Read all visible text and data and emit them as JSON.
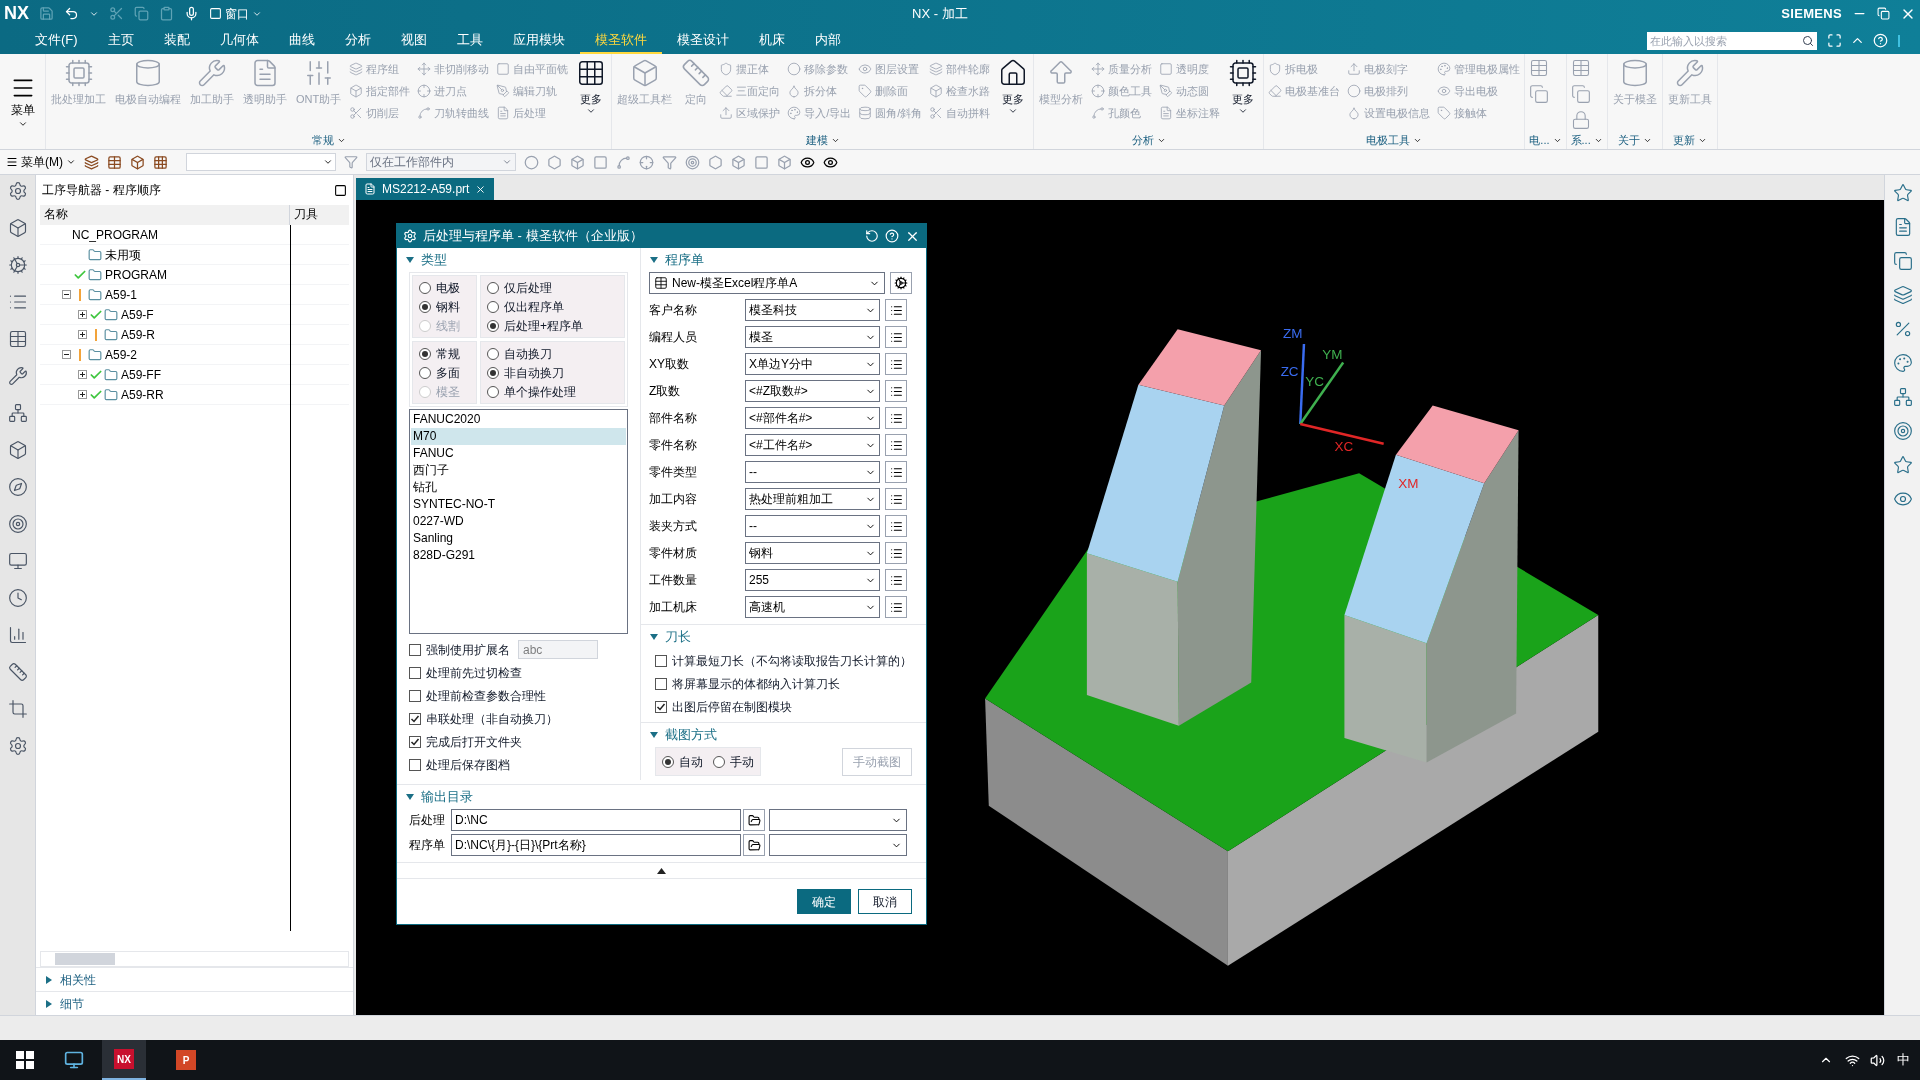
{
  "title_bar": {
    "logo": "NX",
    "window_menu": "窗口",
    "title": "NX - 加工",
    "brand": "SIEMENS"
  },
  "menu_tabs": [
    {
      "label": "文件(F)",
      "selected": false
    },
    {
      "label": "主页",
      "selected": false
    },
    {
      "label": "装配",
      "selected": false
    },
    {
      "label": "几何体",
      "selected": false
    },
    {
      "label": "曲线",
      "selected": false
    },
    {
      "label": "分析",
      "selected": false
    },
    {
      "label": "视图",
      "selected": false
    },
    {
      "label": "工具",
      "selected": false
    },
    {
      "label": "应用模块",
      "selected": false
    },
    {
      "label": "模圣软件",
      "selected": true
    },
    {
      "label": "模圣设计",
      "selected": false
    },
    {
      "label": "机床",
      "selected": false
    },
    {
      "label": "内部",
      "selected": false
    }
  ],
  "search": {
    "placeholder": "在此输入以搜索"
  },
  "ribbon": {
    "menu_button": "菜单",
    "groups": [
      {
        "label": "常规",
        "columns": [
          {
            "kind": "big",
            "label": "批处理加工",
            "disabled": true
          },
          {
            "kind": "big",
            "label": "电极自动编程",
            "disabled": true
          },
          {
            "kind": "big",
            "label": "加工助手",
            "disabled": true
          },
          {
            "kind": "big",
            "label": "透明助手",
            "disabled": true
          },
          {
            "kind": "big",
            "label": "ONT助手",
            "disabled": true
          },
          {
            "kind": "stack",
            "items": [
              {
                "label": "程序组",
                "disabled": true
              },
              {
                "label": "指定部件",
                "disabled": true
              },
              {
                "label": "切削层",
                "disabled": true
              }
            ]
          },
          {
            "kind": "stack",
            "items": [
              {
                "label": "非切削移动",
                "disabled": true
              },
              {
                "label": "进刀点",
                "disabled": true
              },
              {
                "label": "刀轨转曲线",
                "disabled": true
              }
            ]
          },
          {
            "kind": "stack",
            "items": [
              {
                "label": "自由平面铣",
                "disabled": true
              },
              {
                "label": "编辑刀轨",
                "disabled": true
              },
              {
                "label": "后处理",
                "disabled": true
              }
            ]
          },
          {
            "kind": "big",
            "label": "更多",
            "disabled": false
          }
        ]
      },
      {
        "label": "建模",
        "columns": [
          {
            "kind": "big",
            "label": "超级工具栏",
            "disabled": true
          },
          {
            "kind": "big",
            "label": "定向",
            "disabled": true
          },
          {
            "kind": "stack",
            "items": [
              {
                "label": "摆正体",
                "disabled": true
              },
              {
                "label": "三面定向",
                "disabled": true
              },
              {
                "label": "区域保护",
                "disabled": true
              }
            ]
          },
          {
            "kind": "stack",
            "items": [
              {
                "label": "移除参数",
                "disabled": true
              },
              {
                "label": "拆分体",
                "disabled": true
              },
              {
                "label": "导入/导出",
                "disabled": true
              }
            ]
          },
          {
            "kind": "stack",
            "items": [
              {
                "label": "图层设置",
                "disabled": true
              },
              {
                "label": "删除面",
                "disabled": true
              },
              {
                "label": "圆角/斜角",
                "disabled": true
              }
            ]
          },
          {
            "kind": "stack",
            "items": [
              {
                "label": "部件轮廓",
                "disabled": true
              },
              {
                "label": "检查水路",
                "disabled": true
              },
              {
                "label": "自动拼料",
                "disabled": true
              }
            ]
          },
          {
            "kind": "big",
            "label": "更多",
            "disabled": false
          }
        ]
      },
      {
        "label": "分析",
        "columns": [
          {
            "kind": "big",
            "label": "模型分析",
            "disabled": true
          },
          {
            "kind": "stack",
            "items": [
              {
                "label": "质量分析",
                "disabled": true
              },
              {
                "label": "颜色工具",
                "disabled": true
              },
              {
                "label": "孔颜色",
                "disabled": true
              }
            ]
          },
          {
            "kind": "stack",
            "items": [
              {
                "label": "透明度",
                "disabled": true
              },
              {
                "label": "动态圆",
                "disabled": true
              },
              {
                "label": "坐标注释",
                "disabled": true
              }
            ]
          },
          {
            "kind": "big",
            "label": "更多",
            "disabled": false
          }
        ]
      },
      {
        "label": "电极工具",
        "columns": [
          {
            "kind": "stack",
            "items": [
              {
                "label": "拆电极",
                "disabled": true
              },
              {
                "label": "电极基准台",
                "disabled": true
              }
            ]
          },
          {
            "kind": "stack",
            "items": [
              {
                "label": "电极刻字",
                "disabled": true
              },
              {
                "label": "电极排列",
                "disabled": true
              },
              {
                "label": "设置电极信息",
                "disabled": true
              }
            ]
          },
          {
            "kind": "stack",
            "items": [
              {
                "label": "管理电极属性",
                "disabled": true
              },
              {
                "label": "导出电极",
                "disabled": true
              },
              {
                "label": "接触体",
                "disabled": true
              }
            ]
          }
        ]
      },
      {
        "label": "电...",
        "columns": [
          {
            "kind": "icons",
            "items": [
              {
                "disabled": true
              },
              {
                "disabled": true
              }
            ]
          }
        ]
      },
      {
        "label": "系...",
        "columns": [
          {
            "kind": "icons",
            "items": [
              {
                "disabled": true
              },
              {
                "disabled": true
              },
              {
                "disabled": true
              }
            ]
          }
        ]
      },
      {
        "label": "关于",
        "columns": [
          {
            "kind": "big",
            "label": "关于模圣",
            "disabled": true
          }
        ]
      },
      {
        "label": "更新",
        "columns": [
          {
            "kind": "big",
            "label": "更新工具",
            "disabled": true
          }
        ]
      }
    ]
  },
  "toolbar": {
    "menu": "菜单(M)",
    "filter": "仅在工作部件内"
  },
  "navigator": {
    "title": "工序导航器 - 程序顺序",
    "columns": [
      "名称",
      "刀具"
    ],
    "tree": [
      {
        "label": "NC_PROGRAM",
        "children": [
          {
            "label": "未用项"
          },
          {
            "label": "PROGRAM",
            "complete": true
          },
          {
            "label": "A59-1",
            "needs_update": true,
            "expanded": true,
            "children": [
              {
                "label": "A59-F",
                "complete": true,
                "expanded": false
              },
              {
                "label": "A59-R",
                "needs_update": true,
                "expanded": false
              }
            ]
          },
          {
            "label": "A59-2",
            "needs_update": true,
            "expanded": true,
            "children": [
              {
                "label": "A59-FF",
                "complete": true,
                "expanded": false
              },
              {
                "label": "A59-RR",
                "complete": true,
                "expanded": false
              }
            ]
          }
        ]
      }
    ],
    "panels": [
      {
        "label": "相关性",
        "expanded": false
      },
      {
        "label": "细节",
        "expanded": false
      }
    ]
  },
  "file_tab": {
    "label": "MS2212-A59.prt"
  },
  "viewport": {
    "axis_labels": [
      "ZM",
      "YM",
      "ZC",
      "YC",
      "XC",
      "XM"
    ]
  },
  "dialog": {
    "title": "后处理与程序单 - 模圣软件（企业版）",
    "type_section": {
      "title": "类型",
      "expanded": true,
      "radio_groups": [
        {
          "options": [
            {
              "label": "电极",
              "selected": false,
              "disabled": false
            },
            {
              "label": "钢料",
              "selected": true,
              "disabled": false
            },
            {
              "label": "线割",
              "selected": false,
              "disabled": true
            }
          ]
        },
        {
          "options": [
            {
              "label": "仅后处理",
              "selected": false,
              "disabled": false
            },
            {
              "label": "仅出程序单",
              "selected": false,
              "disabled": false
            },
            {
              "label": "后处理+程序单",
              "selected": true,
              "disabled": false
            }
          ]
        },
        {
          "options": [
            {
              "label": "常规",
              "selected": true,
              "disabled": false
            },
            {
              "label": "多面",
              "selected": false,
              "disabled": false
            },
            {
              "label": "模圣",
              "selected": false,
              "disabled": true
            }
          ]
        },
        {
          "options": [
            {
              "label": "自动换刀",
              "selected": false,
              "disabled": false
            },
            {
              "label": "非自动换刀",
              "selected": true,
              "disabled": false
            },
            {
              "label": "单个操作处理",
              "selected": false,
              "disabled": false
            }
          ]
        }
      ],
      "post_list": [
        {
          "label": "FANUC2020",
          "selected": false
        },
        {
          "label": "M70",
          "selected": true
        },
        {
          "label": "FANUC",
          "selected": false
        },
        {
          "label": "西门子",
          "selected": false
        },
        {
          "label": "钻孔",
          "selected": false
        },
        {
          "label": "SYNTEC-NO-T",
          "selected": false
        },
        {
          "label": "0227-WD",
          "selected": false
        },
        {
          "label": "Sanling",
          "selected": false
        },
        {
          "label": "828D-G291",
          "selected": false
        }
      ],
      "ext_checkbox": {
        "label": "强制使用扩展名",
        "checked": false
      },
      "ext_field": {
        "placeholder": "abc",
        "disabled": true
      },
      "checkboxes": [
        {
          "label": "处理前先过切检查",
          "checked": false
        },
        {
          "label": "处理前检查参数合理性",
          "checked": false
        },
        {
          "label": "串联处理（非自动换刀）",
          "checked": true
        },
        {
          "label": "完成后打开文件夹",
          "checked": true
        },
        {
          "label": "处理后保存图档",
          "checked": false
        }
      ]
    },
    "sheet_section": {
      "title": "程序单",
      "expanded": true,
      "template": "New-模圣Excel程序单A",
      "fields": [
        {
          "label": "客户名称",
          "value": "模圣科技"
        },
        {
          "label": "编程人员",
          "value": "模圣"
        },
        {
          "label": "XY取数",
          "value": "X单边Y分中"
        },
        {
          "label": "Z取数",
          "value": "<#Z取数#>"
        },
        {
          "label": "部件名称",
          "value": "<#部件名#>"
        },
        {
          "label": "零件名称",
          "value": "<#工件名#>"
        },
        {
          "label": "零件类型",
          "value": "--"
        },
        {
          "label": "加工内容",
          "value": "热处理前粗加工"
        },
        {
          "label": "装夹方式",
          "value": "--"
        },
        {
          "label": "零件材质",
          "value": "钢料"
        },
        {
          "label": "工件数量",
          "value": "255"
        },
        {
          "label": "加工机床",
          "value": "高速机"
        }
      ]
    },
    "tool_length_section": {
      "title": "刀长",
      "expanded": true,
      "checkboxes": [
        {
          "label": "计算最短刀长（不勾将读取报告刀长计算的）",
          "checked": false
        },
        {
          "label": "将屏幕显示的体都纳入计算刀长",
          "checked": false
        },
        {
          "label": "出图后停留在制图模块",
          "checked": true
        }
      ]
    },
    "capture_section": {
      "title": "截图方式",
      "expanded": true,
      "options": [
        {
          "label": "自动",
          "selected": true
        },
        {
          "label": "手动",
          "selected": false
        }
      ],
      "button": {
        "label": "手动截图",
        "disabled": true
      }
    },
    "output_section": {
      "title": "输出目录",
      "expanded": true,
      "rows": [
        {
          "label": "后处理",
          "value": "D:\\NC"
        },
        {
          "label": "程序单",
          "value": "D:\\NC\\{月}-{日}\\{Prt名称}"
        }
      ]
    },
    "buttons": [
      {
        "label": "确定",
        "kind": "primary"
      },
      {
        "label": "取消",
        "kind": "secondary"
      }
    ]
  },
  "taskbar": {
    "apps": [
      {
        "label": "NX",
        "selected": true
      },
      {
        "label": "P",
        "selected": false
      }
    ],
    "ime": "中"
  }
}
